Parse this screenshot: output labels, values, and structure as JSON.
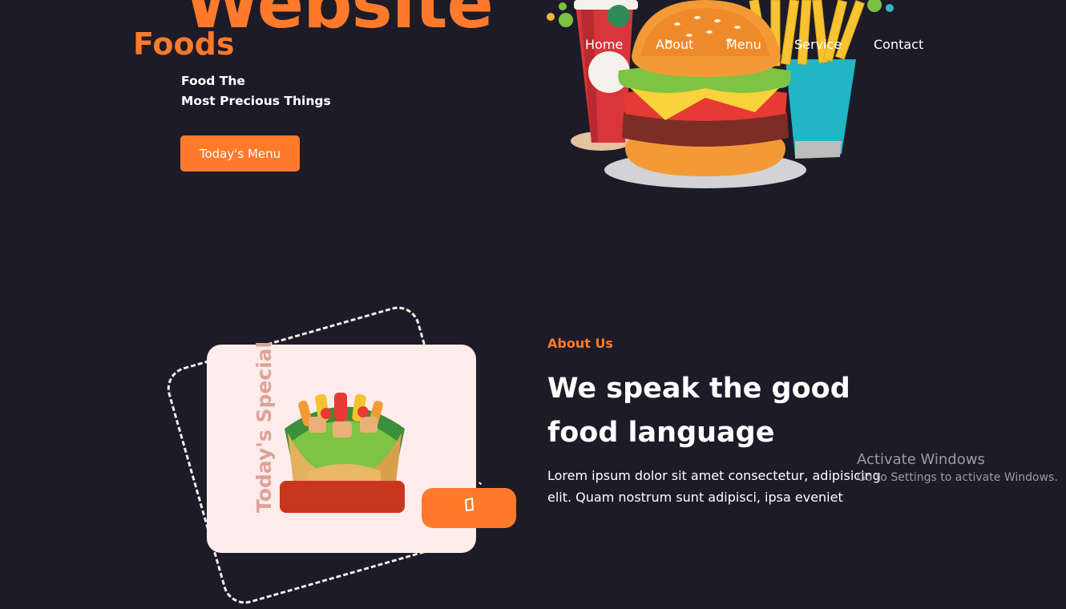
{
  "hero": {
    "big_word": "Website",
    "logo": "Foods",
    "tagline_line1": "Food The",
    "tagline_line2": "Most Precious Things",
    "cta_label": "Today's Menu"
  },
  "nav": {
    "items": [
      {
        "label": "Home"
      },
      {
        "label": "About"
      },
      {
        "label": "Menu"
      },
      {
        "label": "Service"
      },
      {
        "label": "Contact"
      }
    ]
  },
  "about": {
    "card_vertical_text": "Today's Special",
    "label": "About Us",
    "heading_line1": "We speak the good",
    "heading_line2": "food language",
    "paragraph_line1": "Lorem ipsum dolor sit amet consectetur, adipisicing",
    "paragraph_line2": "elit. Quam nostrum sunt adipisci, ipsa eveniet"
  },
  "os_overlay": {
    "title": "Activate Windows",
    "subtitle": "Go to Settings to activate Windows."
  },
  "colors": {
    "background": "#1e1b28",
    "accent": "#ff7a2a",
    "card": "#fdecea",
    "text": "#ffffff"
  },
  "icons": [
    "burger-fries-drink-illustration",
    "wrap-illustration",
    "cup-icon"
  ]
}
